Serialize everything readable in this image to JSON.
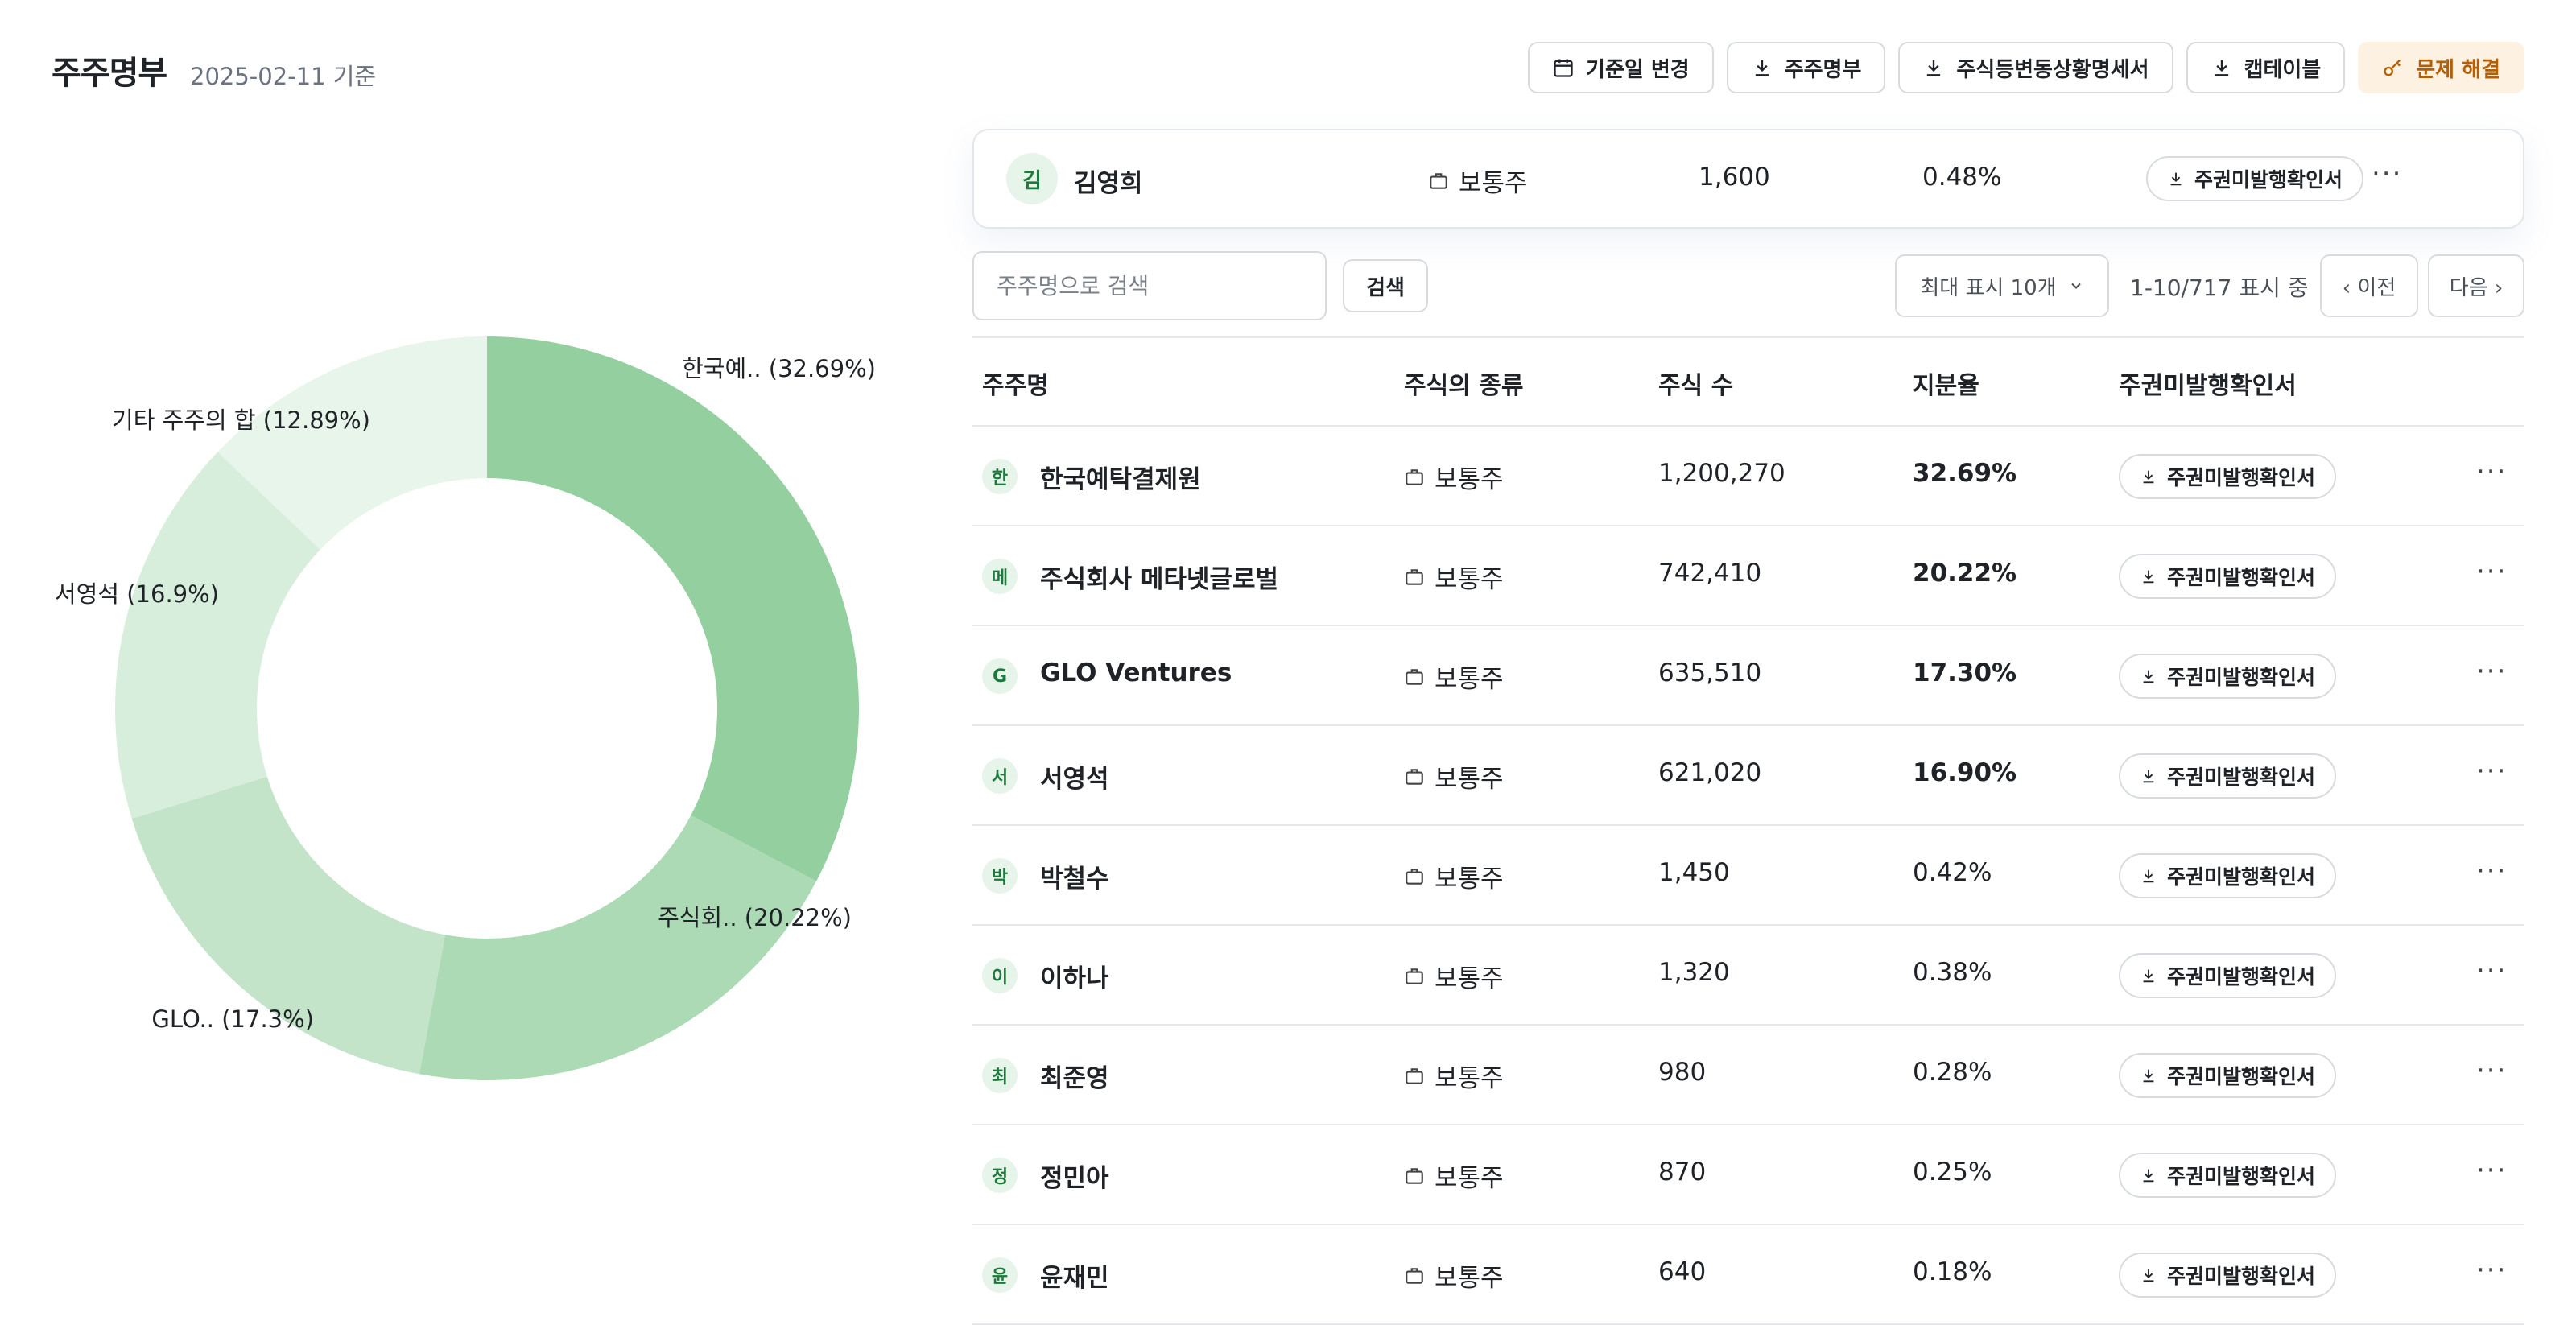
{
  "header": {
    "title": "주주명부",
    "subtitle": "2025-02-11 기준",
    "buttons": [
      {
        "label": "기준일 변경",
        "icon": "calendar-icon"
      },
      {
        "label": "주주명부",
        "icon": "download-icon"
      },
      {
        "label": "주식등변동상황명세서",
        "icon": "download-icon"
      },
      {
        "label": "캡테이블",
        "icon": "download-icon"
      },
      {
        "label": "문제 해결",
        "icon": "key-icon"
      }
    ]
  },
  "highlight": {
    "avatar": "김",
    "name": "김영희",
    "stock_type": "보통주",
    "shares": "1,600",
    "ratio": "0.48%",
    "cert_label": "주권미발행확인서"
  },
  "search": {
    "placeholder": "주주명으로 검색",
    "button": "검색",
    "page_size": "최대 표시 10개",
    "range": "1-10/717 표시 중",
    "prev": "‹ 이전",
    "next": "다음 ›"
  },
  "table": {
    "headers": [
      "주주명",
      "주식의 종류",
      "주식 수",
      "지분율",
      "주권미발행확인서"
    ],
    "rows": [
      {
        "avatar": "한",
        "name": "한국예탁결제원",
        "type": "보통주",
        "shares": "1,200,270",
        "ratio": "32.69%",
        "bold": true,
        "cert": "주권미발행확인서"
      },
      {
        "avatar": "메",
        "name": "주식회사 메타넷글로벌",
        "type": "보통주",
        "shares": "742,410",
        "ratio": "20.22%",
        "bold": true,
        "cert": "주권미발행확인서"
      },
      {
        "avatar": "G",
        "name": "GLO Ventures",
        "type": "보통주",
        "shares": "635,510",
        "ratio": "17.30%",
        "bold": true,
        "cert": "주권미발행확인서"
      },
      {
        "avatar": "서",
        "name": "서영석",
        "type": "보통주",
        "shares": "621,020",
        "ratio": "16.90%",
        "bold": true,
        "cert": "주권미발행확인서"
      },
      {
        "avatar": "박",
        "name": "박철수",
        "type": "보통주",
        "shares": "1,450",
        "ratio": "0.42%",
        "bold": false,
        "cert": "주권미발행확인서"
      },
      {
        "avatar": "이",
        "name": "이하나",
        "type": "보통주",
        "shares": "1,320",
        "ratio": "0.38%",
        "bold": false,
        "cert": "주권미발행확인서"
      },
      {
        "avatar": "최",
        "name": "최준영",
        "type": "보통주",
        "shares": "980",
        "ratio": "0.28%",
        "bold": false,
        "cert": "주권미발행확인서"
      },
      {
        "avatar": "정",
        "name": "정민아",
        "type": "보통주",
        "shares": "870",
        "ratio": "0.25%",
        "bold": false,
        "cert": "주권미발행확인서"
      },
      {
        "avatar": "윤",
        "name": "윤재민",
        "type": "보통주",
        "shares": "640",
        "ratio": "0.18%",
        "bold": false,
        "cert": "주권미발행확인서"
      }
    ]
  },
  "chart_data": {
    "type": "pie",
    "donut": true,
    "slices": [
      {
        "label": "한국예.. (32.69%)",
        "value": 32.69,
        "color": "#94cf9f"
      },
      {
        "label": "주식회.. (20.22%)",
        "value": 20.22,
        "color": "#acdab4"
      },
      {
        "label": "GLO.. (17.3%)",
        "value": 17.3,
        "color": "#c3e4c9"
      },
      {
        "label": "서영석 (16.9%)",
        "value": 16.9,
        "color": "#d8eedc"
      },
      {
        "label": "기타 주주의 합 (12.89%)",
        "value": 12.89,
        "color": "#e8f5ea"
      }
    ]
  },
  "colors": {
    "accent_green": "#1e7a3c",
    "warn_bg": "#fdf1e2",
    "warn_text": "#b45f06",
    "border": "#d7dbe0"
  }
}
